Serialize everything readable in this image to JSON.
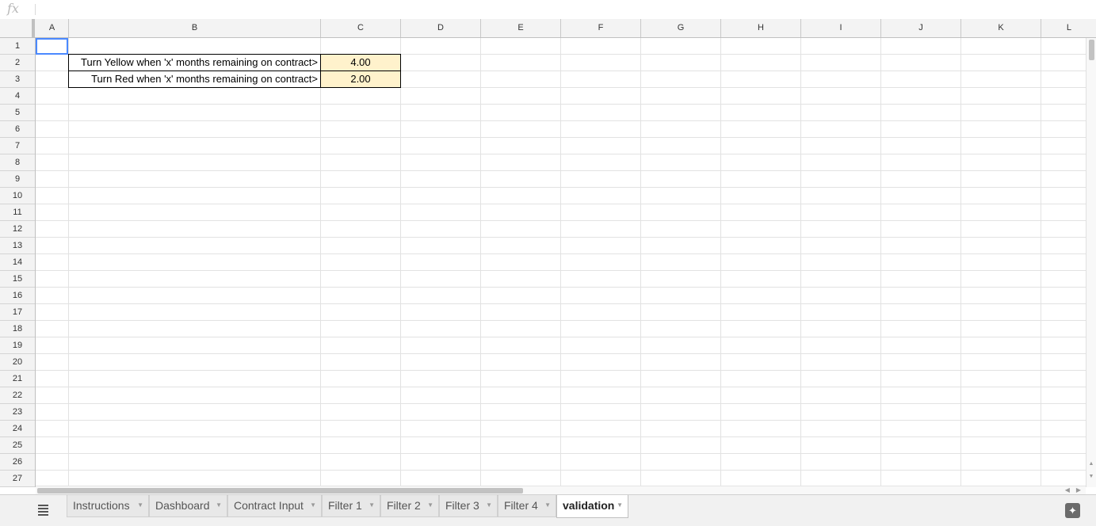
{
  "formula_bar": {
    "fx_label": "fx",
    "value": ""
  },
  "columns": [
    "A",
    "B",
    "C",
    "D",
    "E",
    "F",
    "G",
    "H",
    "I",
    "J",
    "K",
    "L"
  ],
  "rows": [
    "1",
    "2",
    "3",
    "4",
    "5",
    "6",
    "7",
    "8",
    "9",
    "10",
    "11",
    "12",
    "13",
    "14",
    "15",
    "16",
    "17",
    "18",
    "19",
    "20",
    "21",
    "22",
    "23",
    "24",
    "25",
    "26",
    "27"
  ],
  "cells": {
    "B2": "Turn Yellow when 'x' months remaining on contract>",
    "C2": "4.00",
    "B3": "Turn Red when 'x' months remaining on contract>",
    "C3": "2.00"
  },
  "selected_cell": "A1",
  "highlight_color": "#fff2cc",
  "sheet_tabs": [
    {
      "label": "Instructions"
    },
    {
      "label": "Dashboard"
    },
    {
      "label": "Contract Input"
    },
    {
      "label": "Filter 1"
    },
    {
      "label": "Filter 2"
    },
    {
      "label": "Filter 3"
    },
    {
      "label": "Filter 4"
    },
    {
      "label": "validation",
      "active": true
    }
  ],
  "icons": {
    "sheets_menu": "all-sheets-icon",
    "explore": "explore-icon",
    "tab_menu": "caret-down-icon"
  }
}
